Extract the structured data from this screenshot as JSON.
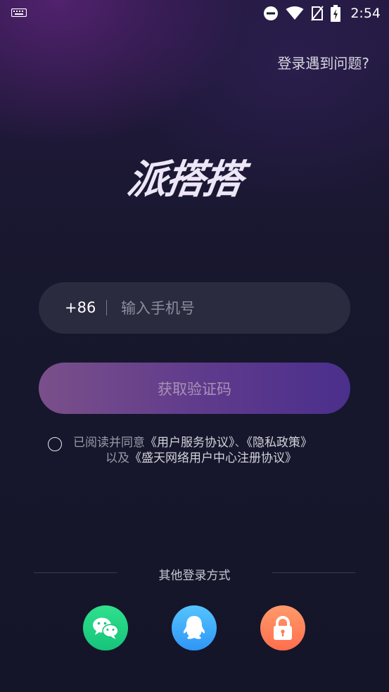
{
  "status_bar": {
    "time": "2:54"
  },
  "help": {
    "label": "登录遇到问题?"
  },
  "logo": {
    "text": "派搭搭"
  },
  "phone": {
    "country_code": "+86",
    "placeholder": "输入手机号",
    "value": ""
  },
  "get_code": {
    "label": "获取验证码"
  },
  "agreement": {
    "prefix": "已阅读并同意",
    "user_agreement": "《用户服务协议》",
    "sep": "、",
    "privacy": "《隐私政策》",
    "line2_prefix": "以及",
    "center_agreement": "《盛天网络用户中心注册协议》"
  },
  "other_login": {
    "label": "其他登录方式",
    "methods": [
      {
        "name": "wechat",
        "icon": "wechat-icon",
        "color": "#1fd07f"
      },
      {
        "name": "qq",
        "icon": "qq-icon",
        "color": "#3aa8fa"
      },
      {
        "name": "password",
        "icon": "lock-icon",
        "color": "#ff8058"
      }
    ]
  }
}
